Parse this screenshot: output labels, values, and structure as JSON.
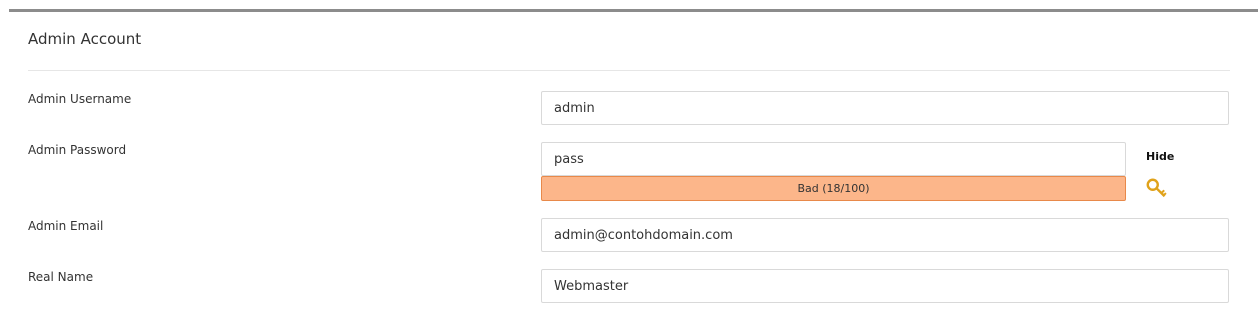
{
  "section": {
    "title": "Admin Account"
  },
  "fields": {
    "username": {
      "label": "Admin Username",
      "value": "admin"
    },
    "password": {
      "label": "Admin Password",
      "value": "pass",
      "toggle_label": "Hide",
      "strength_text": "Bad (18/100)",
      "strength_score": 18
    },
    "email": {
      "label": "Admin Email",
      "value": "admin@contohdomain.com"
    },
    "realname": {
      "label": "Real Name",
      "value": "Webmaster"
    }
  },
  "colors": {
    "strength_bad": "#fcb68a",
    "key_icon": "#e0a21a"
  },
  "icons": {
    "generate_password": "key-icon"
  }
}
